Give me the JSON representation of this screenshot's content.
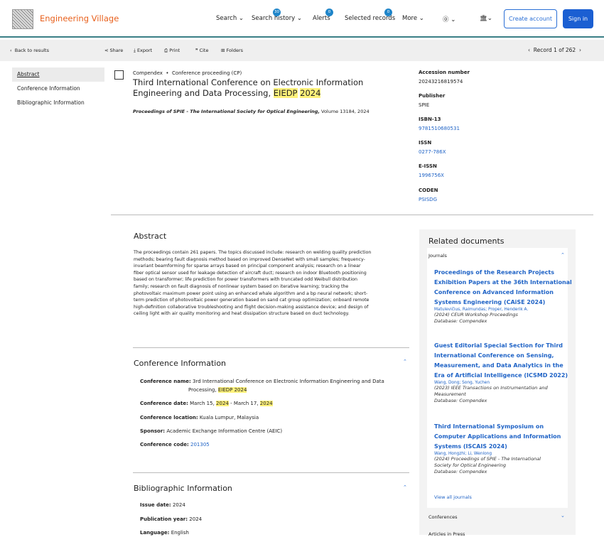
{
  "header": {
    "brand": "Engineering Village",
    "nav": {
      "search": "Search",
      "history": "Search history",
      "history_badge": "30",
      "alerts": "Alerts",
      "alerts_badge": "0",
      "selected": "Selected records",
      "selected_badge": "0",
      "more": "More"
    },
    "create_account": "Create account",
    "sign_in": "Sign in"
  },
  "toolbar": {
    "back": "Back to results",
    "share": "Share",
    "export": "Export",
    "print": "Print",
    "cite": "Cite",
    "folders": "Folders",
    "record": "Record 1 of 262"
  },
  "sidebar": {
    "items": [
      "Abstract",
      "Conference Information",
      "Bibliographic Information"
    ]
  },
  "record": {
    "type_source": "Compendex",
    "type_kind": "Conference proceeding (CP)",
    "title_1": "Third International Conference on Electronic Information",
    "title_2a": "Engineering and Data Processing,",
    "title_2b": "EIEDP",
    "title_2c": "2024",
    "source_title": "Proceedings of SPIE - The International Society for Optical Engineering,",
    "source_vol": " Volume 13184, 2024"
  },
  "meta": [
    {
      "label": "Accession number",
      "value": "20243216819574"
    },
    {
      "label": "Publisher",
      "value": "SPIE"
    },
    {
      "label": "ISBN-13",
      "value": "9781510680531"
    },
    {
      "label": "ISSN",
      "value": "0277-786X"
    },
    {
      "label": "E-ISSN",
      "value": "1996756X"
    },
    {
      "label": "CODEN",
      "value": "PSISDG"
    }
  ],
  "abstract": {
    "heading": "Abstract",
    "lines": [
      "The proceedings contain 261 papers. The topics discussed include: research on welding quality prediction",
      "methods; bearing fault diagnosis method based on improved DenseNet with small samples; frequency-",
      "invariant beamforming for sparse arrays based on principal component analysis; research on a linear",
      "fiber optical sensor used for leakage detection of aircraft duct; research on indoor Bluetooth positioning",
      "based on transformer; life prediction for power transformers with truncated odd Weibull distribution",
      "family; research on fault diagnosis of nonlinear system based on iterative learning; tracking the",
      "photovoltaic maximum power point using an enhanced whale algorithm and a bp neural network; short-",
      "term prediction of photovoltaic power generation based on sand cat group optimization; onboard remote",
      "high-definition collaborative troubleshooting and flight decision-making assistance device; and design of",
      "ceiling light with air quality monitoring and heat dissipation structure based on duct technology."
    ]
  },
  "conference": {
    "heading": "Conference Information",
    "name_label": "Conference name:",
    "name_1": "3rd International Conference on Electronic Information Engineering and Data",
    "name_2": "Processing,",
    "name_hl": "EIEDP 2024",
    "date_label": "Conference date:",
    "date_a": "March 15,",
    "date_hl1": "2024",
    "date_b": "- March 17,",
    "date_hl2": "2024",
    "loc_label": "Conference location:",
    "loc": "Kuala Lumpur, Malaysia",
    "sponsor_label": "Sponsor:",
    "sponsor": "Academic Exchange Information Centre (AEIC)",
    "code_label": "Conference code:",
    "code": "201305"
  },
  "biblio": {
    "heading": "Bibliographic Information",
    "issue_label": "Issue date:",
    "issue": "2024",
    "pub_label": "Publication year:",
    "pub": "2024",
    "lang_label": "Language:",
    "lang": "English"
  },
  "related": {
    "heading": "Related documents",
    "journals": "Journals",
    "docs": [
      {
        "t1": "Proceedings of the Research Projects",
        "t2": "Exhibition Papers at the 36th International",
        "t3": "Conference on Advanced Information",
        "t4": "Systems Engineering (CAiSE 2024)",
        "authors": "Matulevičius, Raimundas; Proper, Henderik A.",
        "m1": "(2024) CEUR Workshop Proceedings",
        "m2": "Database: Compendex"
      },
      {
        "t1": "Guest Editorial Special Section for Third",
        "t2": "International Conference on Sensing,",
        "t3": "Measurement, and Data Analytics in the",
        "t4": "Era of Artificial Intelligence (ICSMD 2022)",
        "authors": "Wang, Dong; Song, Yuchen",
        "m1": "(2023) IEEE Transactions on Instrumentation and",
        "m1b": "Measurement",
        "m2": "Database: Compendex"
      },
      {
        "t1": "Third International Symposium on",
        "t2": "Computer Applications and Information",
        "t3": "Systems (ISCAIS 2024)",
        "authors": "Wang, Hongzhi; Li, Wenlong",
        "m1": "(2024) Proceedings of SPIE - The International",
        "m1b": "Society for Optical Engineering",
        "m2": "Database: Compendex"
      }
    ],
    "view_all": "View all journals",
    "conferences": "Conferences",
    "articles": "Articles in Press"
  }
}
